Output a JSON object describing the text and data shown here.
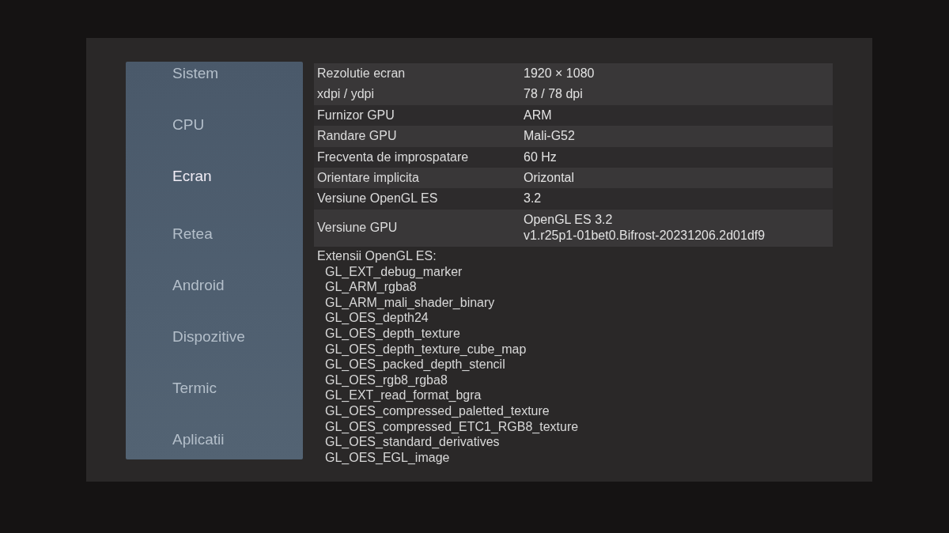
{
  "sidebar": {
    "items": [
      {
        "label": "Sistem",
        "selected": false
      },
      {
        "label": "CPU",
        "selected": false
      },
      {
        "label": "Ecran",
        "selected": true
      },
      {
        "label": "Retea",
        "selected": false
      },
      {
        "label": "Android",
        "selected": false
      },
      {
        "label": "Dispozitive",
        "selected": false
      },
      {
        "label": "Termic",
        "selected": false
      },
      {
        "label": "Aplicatii",
        "selected": false
      }
    ]
  },
  "info_table": {
    "rows": [
      {
        "label": "Rezolutie ecran",
        "value_lines": [
          "1920 × 1080"
        ],
        "shaded": true
      },
      {
        "label": "xdpi / ydpi",
        "value_lines": [
          "78 / 78 dpi"
        ],
        "shaded": true
      },
      {
        "label": "Furnizor GPU",
        "value_lines": [
          "ARM"
        ],
        "shaded": false
      },
      {
        "label": "Randare GPU",
        "value_lines": [
          "Mali-G52"
        ],
        "shaded": true
      },
      {
        "label": "Frecventa de improspatare",
        "value_lines": [
          "60 Hz"
        ],
        "shaded": false
      },
      {
        "label": "Orientare implicita",
        "value_lines": [
          "Orizontal"
        ],
        "shaded": true
      },
      {
        "label": "Versiune OpenGL ES",
        "value_lines": [
          "3.2"
        ],
        "shaded": false
      },
      {
        "label": "Versiune GPU",
        "value_lines": [
          "OpenGL ES 3.2",
          "v1.r25p1-01bet0.Bifrost-20231206.2d01df9"
        ],
        "shaded": true
      }
    ]
  },
  "extensions": {
    "title": "Extensii OpenGL ES:",
    "items": [
      "GL_EXT_debug_marker",
      "GL_ARM_rgba8",
      "GL_ARM_mali_shader_binary",
      "GL_OES_depth24",
      "GL_OES_depth_texture",
      "GL_OES_depth_texture_cube_map",
      "GL_OES_packed_depth_stencil",
      "GL_OES_rgb8_rgba8",
      "GL_EXT_read_format_bgra",
      "GL_OES_compressed_paletted_texture",
      "GL_OES_compressed_ETC1_RGB8_texture",
      "GL_OES_standard_derivatives",
      "GL_OES_EGL_image"
    ]
  }
}
